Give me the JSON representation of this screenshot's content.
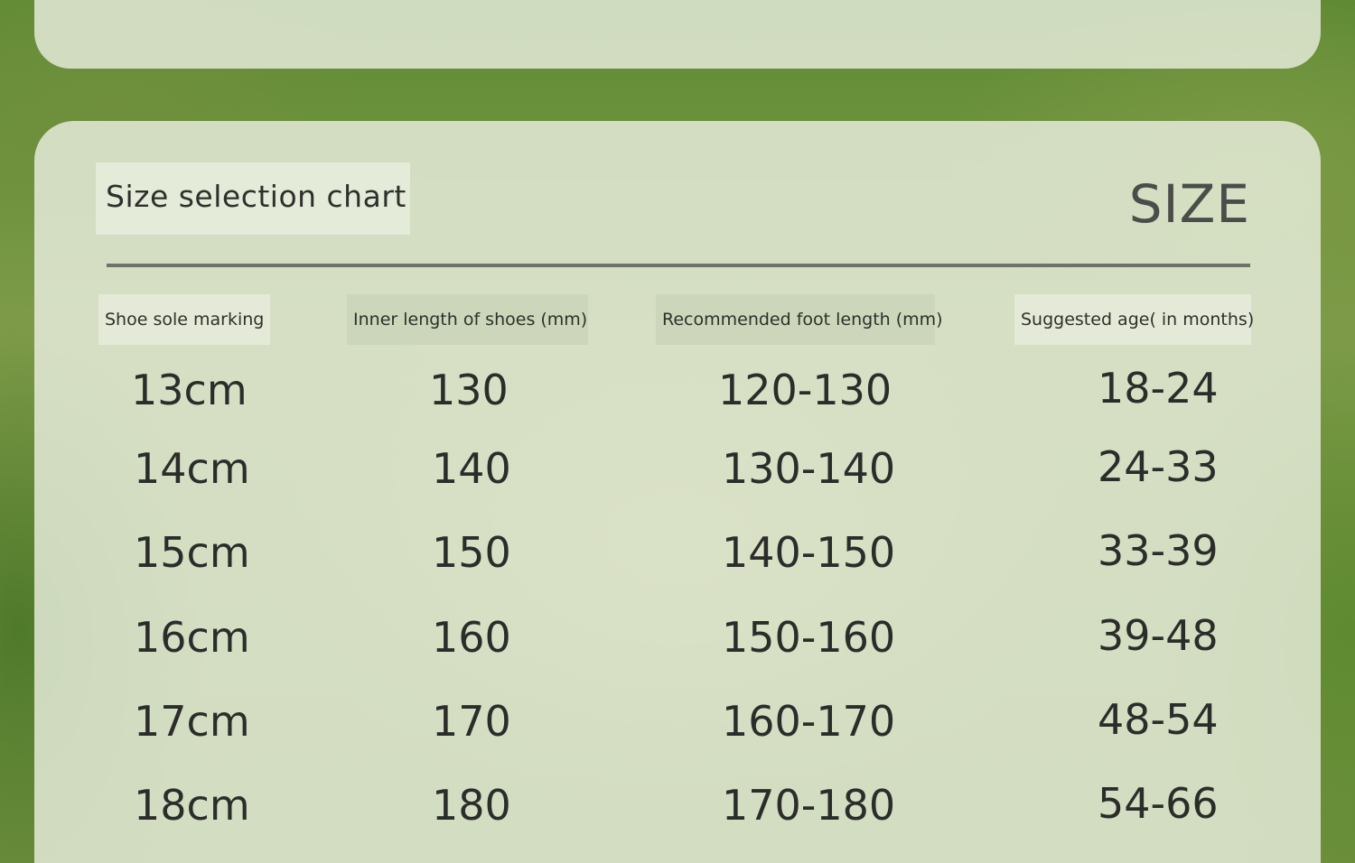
{
  "chart": {
    "title": "Size selection chart",
    "size_label": "SIZE"
  },
  "headers": [
    "Shoe sole marking",
    "Inner length of shoes (mm)",
    "Recommended foot length (mm)",
    "Suggested age( in months)"
  ],
  "rows": [
    [
      "13cm",
      "130",
      "120-130",
      "18-24"
    ],
    [
      "14cm",
      "140",
      "130-140",
      "24-33"
    ],
    [
      "15cm",
      "150",
      "140-150",
      "33-39"
    ],
    [
      "16cm",
      "160",
      "150-160",
      "39-48"
    ],
    [
      "17cm",
      "170",
      "160-170",
      "48-54"
    ],
    [
      "18cm",
      "180",
      "170-180",
      "54-66"
    ]
  ]
}
